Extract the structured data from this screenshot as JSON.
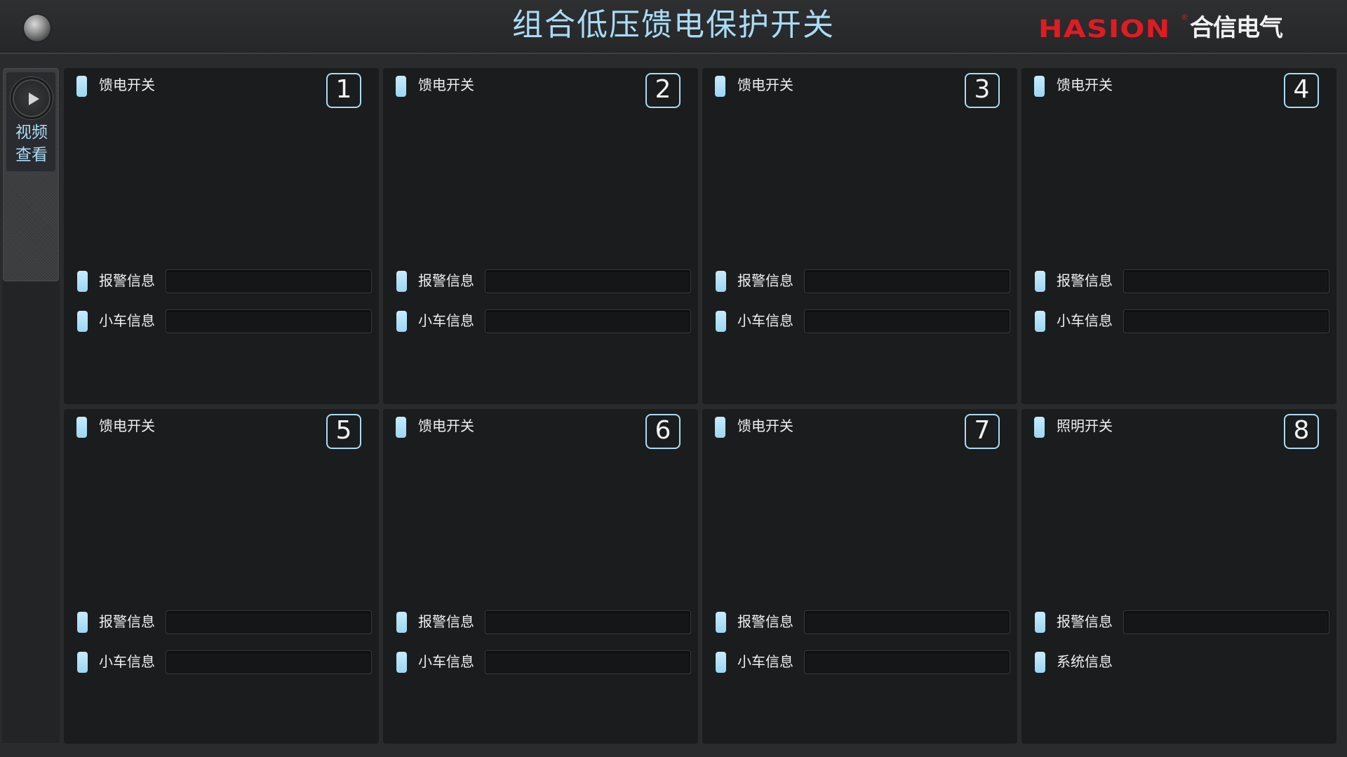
{
  "header": {
    "title": "组合低压馈电保护开关",
    "logo_en": "HASION",
    "logo_reg": "®",
    "logo_cn": "合信电气"
  },
  "sidebar": {
    "video_line1": "视频",
    "video_line2": "查看"
  },
  "cards": [
    {
      "number": "1",
      "title": "馈电开关",
      "row1_label": "报警信息",
      "row2_label": "小车信息"
    },
    {
      "number": "2",
      "title": "馈电开关",
      "row1_label": "报警信息",
      "row2_label": "小车信息"
    },
    {
      "number": "3",
      "title": "馈电开关",
      "row1_label": "报警信息",
      "row2_label": "小车信息"
    },
    {
      "number": "4",
      "title": "馈电开关",
      "row1_label": "报警信息",
      "row2_label": "小车信息"
    },
    {
      "number": "5",
      "title": "馈电开关",
      "row1_label": "报警信息",
      "row2_label": "小车信息"
    },
    {
      "number": "6",
      "title": "馈电开关",
      "row1_label": "报警信息",
      "row2_label": "小车信息"
    },
    {
      "number": "7",
      "title": "馈电开关",
      "row1_label": "报警信息",
      "row2_label": "小车信息"
    },
    {
      "number": "8",
      "title": "照明开关",
      "row1_label": "报警信息",
      "row2_label": "系统信息"
    }
  ],
  "colors": {
    "accent": "#a9dcf6",
    "marker": "#b8e6fc",
    "logo_red": "#e11b22",
    "background": "#2a2b2d",
    "card": "#1b1c1d"
  }
}
